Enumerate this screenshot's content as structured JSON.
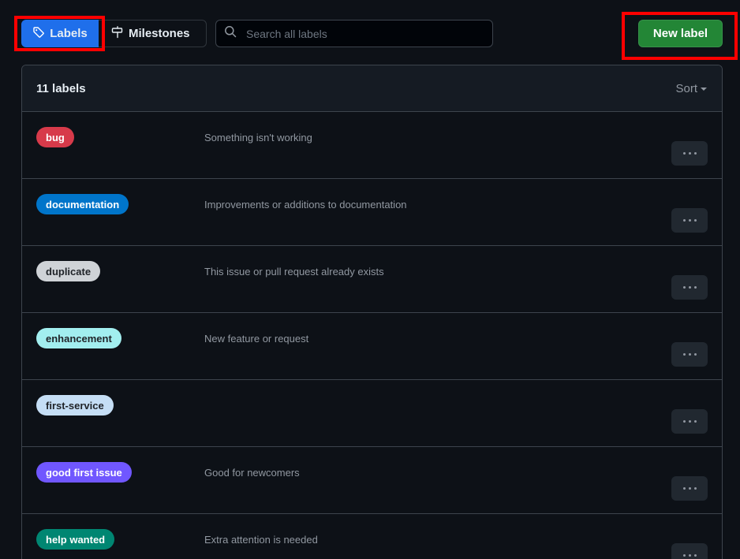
{
  "toolbar": {
    "labels_tab": "Labels",
    "milestones_tab": "Milestones",
    "search_placeholder": "Search all labels",
    "new_label_button": "New label"
  },
  "box": {
    "count_text": "11 labels",
    "sort_label": "Sort"
  },
  "labels": [
    {
      "name": "bug",
      "description": "Something isn't working",
      "bg": "#d73a4a",
      "fg": "#ffffff"
    },
    {
      "name": "documentation",
      "description": "Improvements or additions to documentation",
      "bg": "#0075ca",
      "fg": "#ffffff"
    },
    {
      "name": "duplicate",
      "description": "This issue or pull request already exists",
      "bg": "#cfd3d7",
      "fg": "#1f2328"
    },
    {
      "name": "enhancement",
      "description": "New feature or request",
      "bg": "#a2eeef",
      "fg": "#1f2328"
    },
    {
      "name": "first-service",
      "description": "",
      "bg": "#c5def5",
      "fg": "#1f2328"
    },
    {
      "name": "good first issue",
      "description": "Good for newcomers",
      "bg": "#7057ff",
      "fg": "#ffffff"
    },
    {
      "name": "help wanted",
      "description": "Extra attention is needed",
      "bg": "#008672",
      "fg": "#ffffff"
    }
  ],
  "colors": {
    "accent": "#1f6feb",
    "primary_button": "#238636",
    "highlight": "#ff0000"
  },
  "icons": {
    "labels_tab": "tag-icon",
    "milestones_tab": "milestone-icon",
    "search": "search-icon",
    "sort": "triangle-down-icon",
    "row_action": "kebab-horizontal-icon"
  }
}
